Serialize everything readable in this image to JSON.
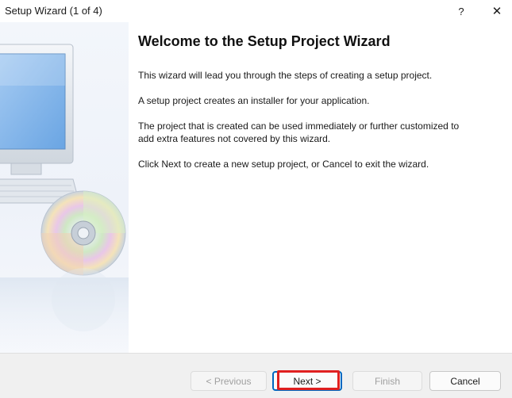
{
  "window": {
    "title": "Setup Wizard (1 of 4)",
    "help_label": "?",
    "close_label": "✕"
  },
  "content": {
    "heading": "Welcome to the Setup Project Wizard",
    "paragraphs": [
      "This wizard will lead you through the steps of creating a setup project.",
      "A setup project creates an installer for your application.",
      "The project that is created can be used immediately or further customized to add extra features not covered by this wizard.",
      "Click Next to create a new setup project, or Cancel to exit the wizard."
    ]
  },
  "buttons": {
    "previous": "< Previous",
    "next": "Next >",
    "finish": "Finish",
    "cancel": "Cancel"
  },
  "colors": {
    "highlight": "#e02020",
    "focus_border": "#0067c0"
  }
}
